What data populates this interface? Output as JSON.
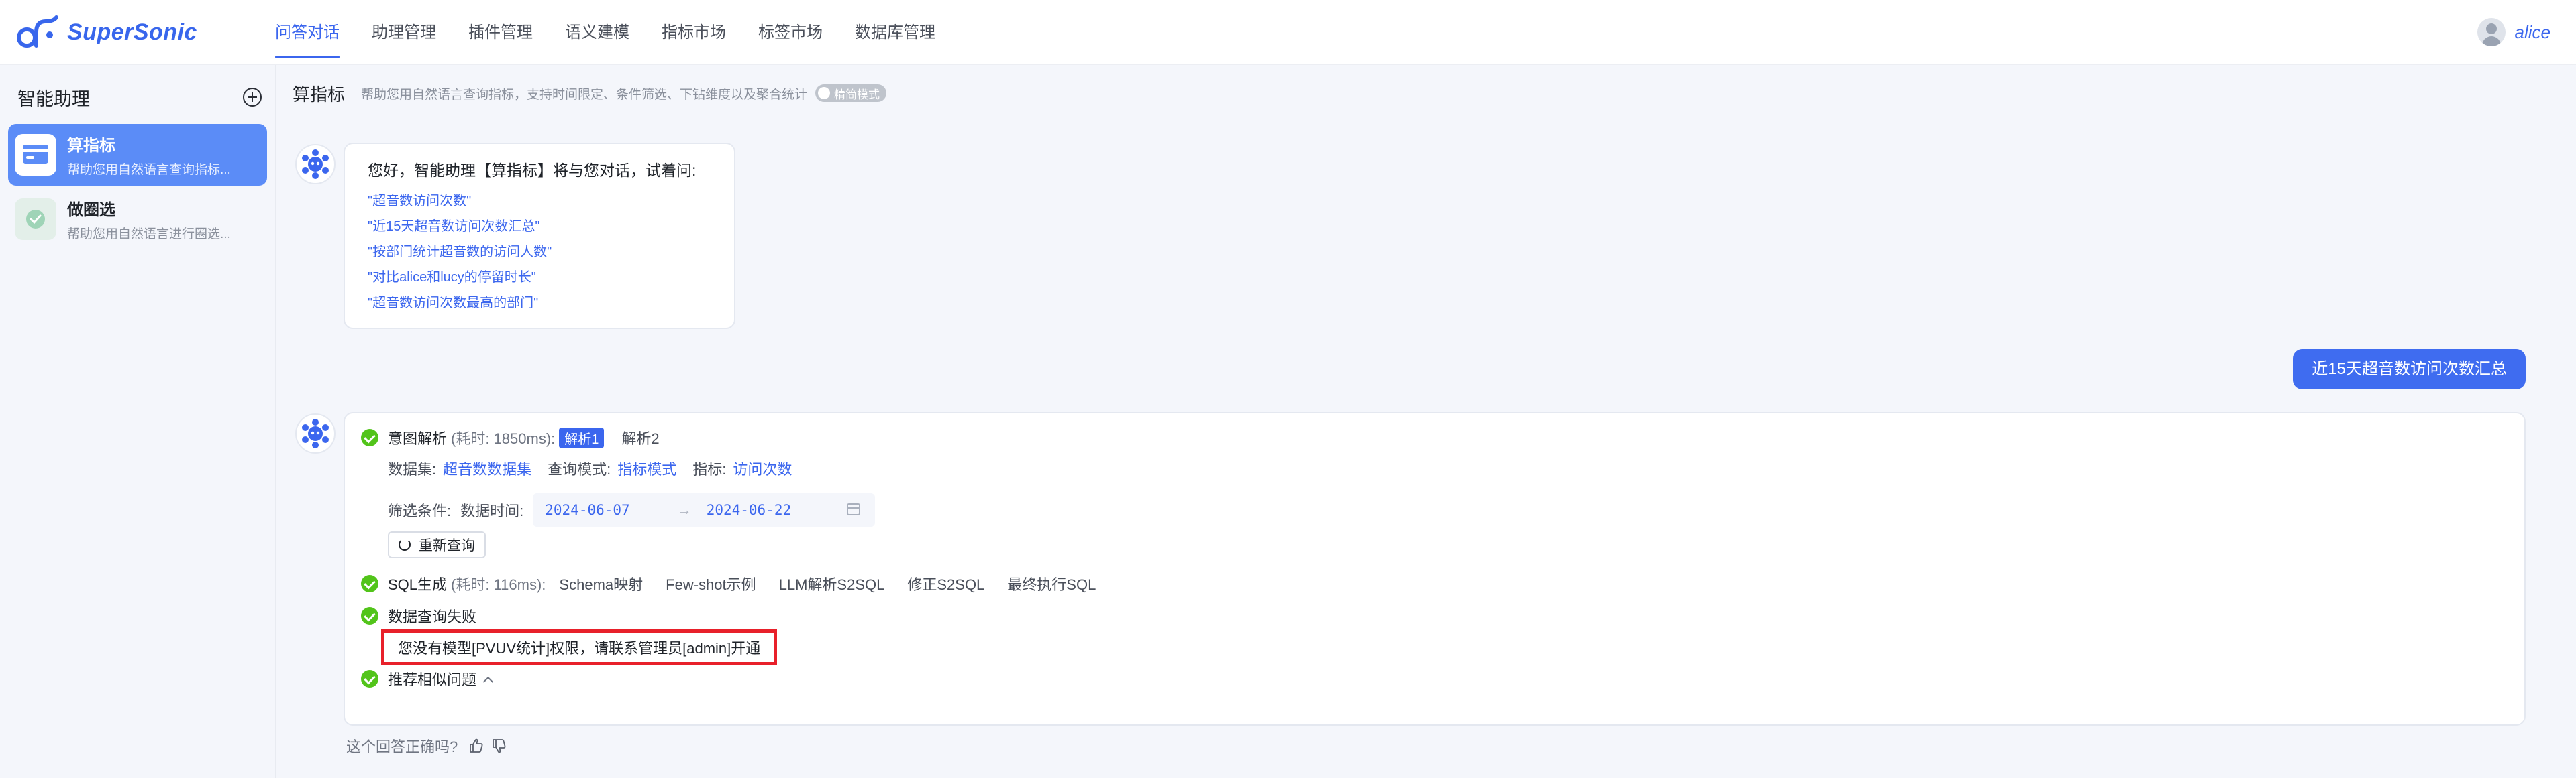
{
  "app": {
    "logo_text": "SuperSonic"
  },
  "nav": {
    "items": [
      "问答对话",
      "助理管理",
      "插件管理",
      "语义建模",
      "指标市场",
      "标签市场",
      "数据库管理"
    ],
    "active_index": 0
  },
  "user": {
    "name": "alice"
  },
  "sidebar": {
    "title": "智能助理",
    "agents": [
      {
        "name": "算指标",
        "desc": "帮助您用自然语言查询指标...",
        "active": true
      },
      {
        "name": "做圈选",
        "desc": "帮助您用自然语言进行圈选...",
        "active": false
      }
    ]
  },
  "header": {
    "title": "算指标",
    "desc": "帮助您用自然语言查询指标，支持时间限定、条件筛选、下钻维度以及聚合统计",
    "mode_label": "精简模式"
  },
  "greeting": {
    "title": "您好，智能助理【算指标】将与您对话，试着问:",
    "suggestions": [
      "\"超音数访问次数\"",
      "\"近15天超音数访问次数汇总\"",
      "\"按部门统计超音数的访问人数\"",
      "\"对比alice和lucy的停留时长\"",
      "\"超音数访问次数最高的部门\""
    ]
  },
  "user_message": "近15天超音数访问次数汇总",
  "answer": {
    "intent": {
      "label": "意图解析",
      "time": "(耗时: 1850ms):",
      "parse_tabs": [
        "解析1",
        "解析2"
      ]
    },
    "meta": {
      "dataset_label": "数据集:",
      "dataset_value": "超音数数据集",
      "mode_label": "查询模式:",
      "mode_value": "指标模式",
      "metric_label": "指标:",
      "metric_value": "访问次数"
    },
    "filter": {
      "label": "筛选条件:",
      "date_label": "数据时间:",
      "start": "2024-06-07",
      "end": "2024-06-22"
    },
    "requery_label": "重新查询",
    "sql": {
      "label": "SQL生成",
      "time": "(耗时: 116ms):",
      "steps": [
        "Schema映射",
        "Few-shot示例",
        "LLM解析S2SQL",
        "修正S2SQL",
        "最终执行SQL"
      ]
    },
    "query_fail": "数据查询失败",
    "error_message": "您没有模型[PVUV统计]权限，请联系管理员[admin]开通",
    "recommend": "推荐相似问题"
  },
  "feedback": {
    "question": "这个回答正确吗?"
  },
  "colors": {
    "accent": "#3b66ee",
    "success": "#52c41a",
    "error_border": "#e8202a"
  }
}
